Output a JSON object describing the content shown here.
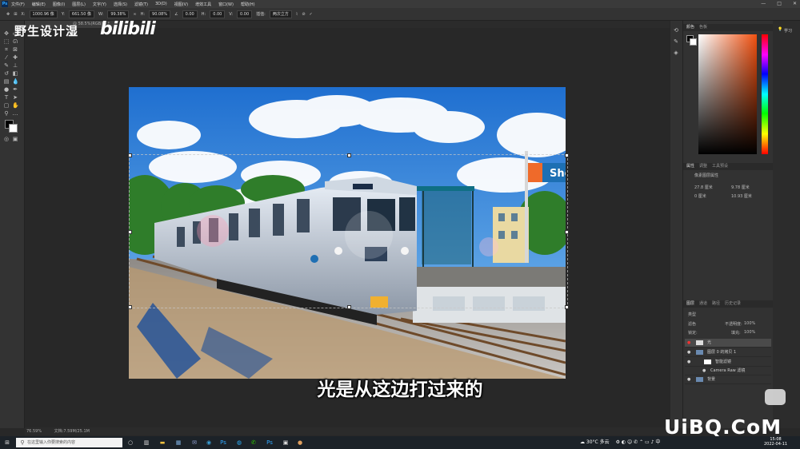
{
  "menubar": {
    "app_icon": "Ps",
    "items": [
      "文件(F)",
      "编辑(E)",
      "图像(I)",
      "图层(L)",
      "文字(Y)",
      "选择(S)",
      "滤镜(T)",
      "3D(D)",
      "视图(V)",
      "增效工具",
      "窗口(W)",
      "帮助(H)"
    ],
    "window_controls": [
      "—",
      "□",
      "✕"
    ]
  },
  "options": {
    "x": "1000.96 像",
    "y": "661.50 像",
    "w": "99.38%",
    "h": "90.08%",
    "angle": "0.00",
    "hskew": "0.00",
    "vskew": "0.00",
    "interp_label": "插值:",
    "interp": "两次立方"
  },
  "tab": {
    "label": "@ 58.5%(RGB/8) *"
  },
  "watermark": {
    "text": "野生设计湿",
    "logo": "bilibili"
  },
  "subtitle": "光是从这边打过来的",
  "status": {
    "zoom": "76.59%",
    "doc": "文档:7.59M/25.1M"
  },
  "color_panel": {
    "tabs": [
      "颜色",
      "色板"
    ]
  },
  "properties": {
    "tabs": [
      "属性",
      "调整",
      "工具预设"
    ],
    "title": "像素图层属性",
    "w": "27.8 厘米",
    "h": "9.78 厘米",
    "x": "0 厘米",
    "y": "10.93 厘米"
  },
  "layers": {
    "tabs": [
      "图层",
      "通道",
      "路径",
      "历史记录"
    ],
    "filter": "类型",
    "blend": "滤色",
    "opacity_label": "不透明度:",
    "opacity": "100%",
    "fill_label": "填充:",
    "fill": "100%",
    "lock_label": "锁定:",
    "items": [
      {
        "name": "光",
        "eye": "●"
      },
      {
        "name": "图层 0 的拷贝 1",
        "eye": "●"
      },
      {
        "name": "智能滤镜",
        "eye": "●"
      },
      {
        "name": "Camera Raw 滤镜",
        "eye": "●"
      },
      {
        "name": "背景",
        "eye": "●"
      }
    ]
  },
  "learn": {
    "label": "学习"
  },
  "taskbar": {
    "search_placeholder": "在这里输入你要搜索的内容",
    "weather": "30°C 多云",
    "time": "15:08",
    "date": "2022-04-11",
    "input": "中"
  },
  "sign_text": "She",
  "uibq": "UiBQ.CoM"
}
